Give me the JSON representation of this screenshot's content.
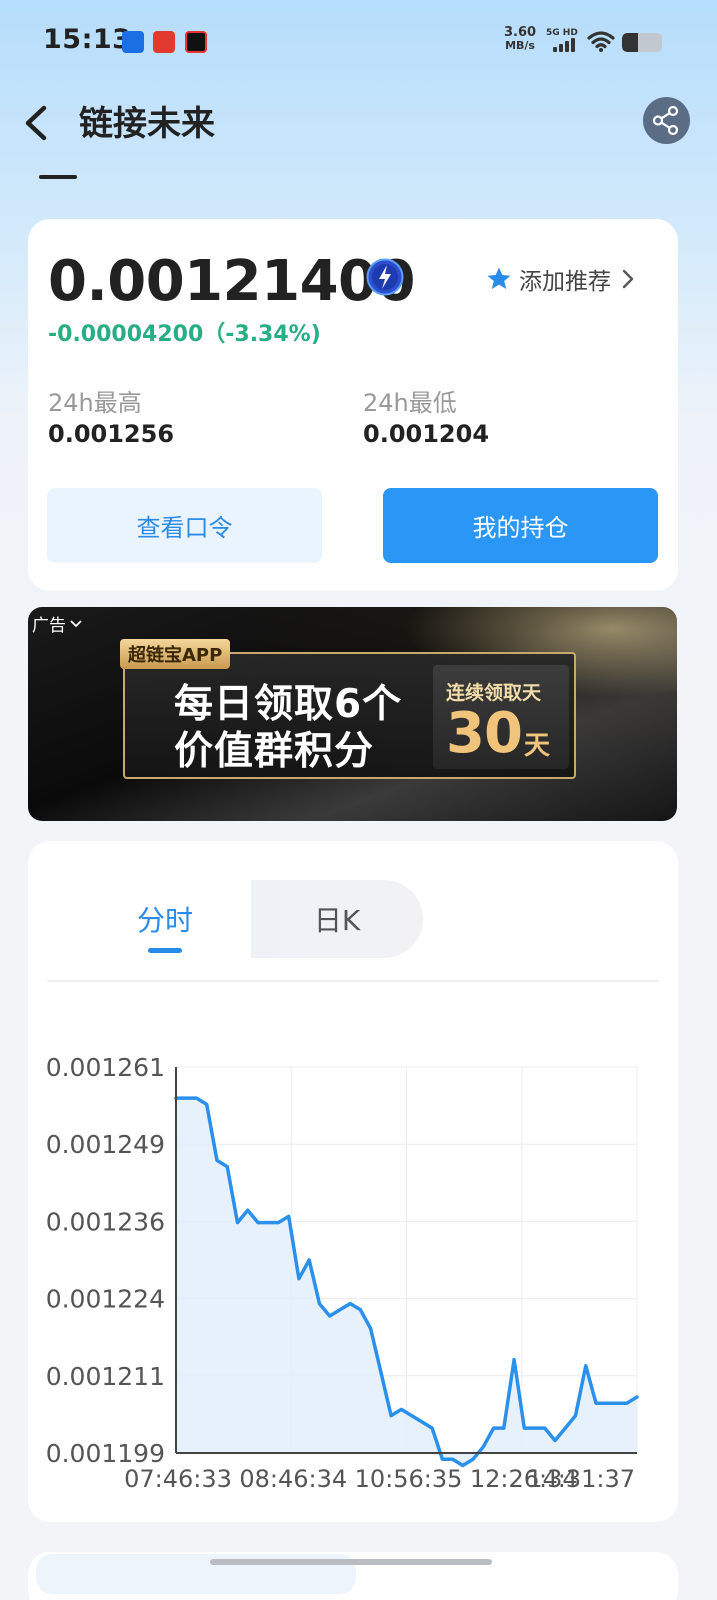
{
  "status_bar": {
    "time": "15:13",
    "net_speed_value": "3.60",
    "net_speed_unit": "MB/s",
    "network_tag": "5G HD",
    "battery_level": 0.4
  },
  "header": {
    "title": "链接未来"
  },
  "price_card": {
    "price": "0.00121400",
    "change": "-0.00004200（-3.34%)",
    "add_recommend": "添加推荐",
    "high_label": "24h最高",
    "high_value": "0.001256",
    "low_label": "24h最低",
    "low_value": "0.001204",
    "view_code_button": "查看口令",
    "my_position_button": "我的持仓"
  },
  "ad": {
    "label": "广告",
    "brand": "超链宝APP",
    "line1": "每日领取6个",
    "line2": "价值群积分",
    "side_top": "连续领取天",
    "side_num": "30",
    "side_unit": "天"
  },
  "chart_tabs": {
    "active": "分时",
    "inactive": "日K"
  },
  "colors": {
    "accent": "#2a8be8",
    "primary_button": "#2a96f5",
    "change_green": "#27ae83",
    "line": "#2a90ec",
    "area_fill": "#e3effc"
  },
  "chart_data": {
    "type": "area",
    "title": "",
    "xlabel": "",
    "ylabel": "",
    "x_ticks": [
      "07:46:33",
      "08:46:34",
      "10:56:35",
      "12:26:34",
      "14:31:37"
    ],
    "y_ticks": [
      "0.001261",
      "0.001249",
      "0.001236",
      "0.001224",
      "0.001211",
      "0.001199"
    ],
    "ylim": [
      0.001199,
      0.001261
    ],
    "grid": true,
    "series": [
      {
        "values": [
          0.001256,
          0.001256,
          0.001256,
          0.001255,
          0.001246,
          0.001245,
          0.001236,
          0.001238,
          0.001236,
          0.001236,
          0.001236,
          0.001237,
          0.001227,
          0.00123,
          0.001223,
          0.001221,
          0.001222,
          0.001223,
          0.001222,
          0.001219,
          0.001212,
          0.001205,
          0.001206,
          0.001205,
          0.001204,
          0.001203,
          0.001198,
          0.001198,
          0.001197,
          0.001198,
          0.0012,
          0.001203,
          0.001203,
          0.001214,
          0.001203,
          0.001203,
          0.001203,
          0.001201,
          0.001203,
          0.001205,
          0.001213,
          0.001207,
          0.001207,
          0.001207,
          0.001207,
          0.001208
        ]
      }
    ]
  }
}
